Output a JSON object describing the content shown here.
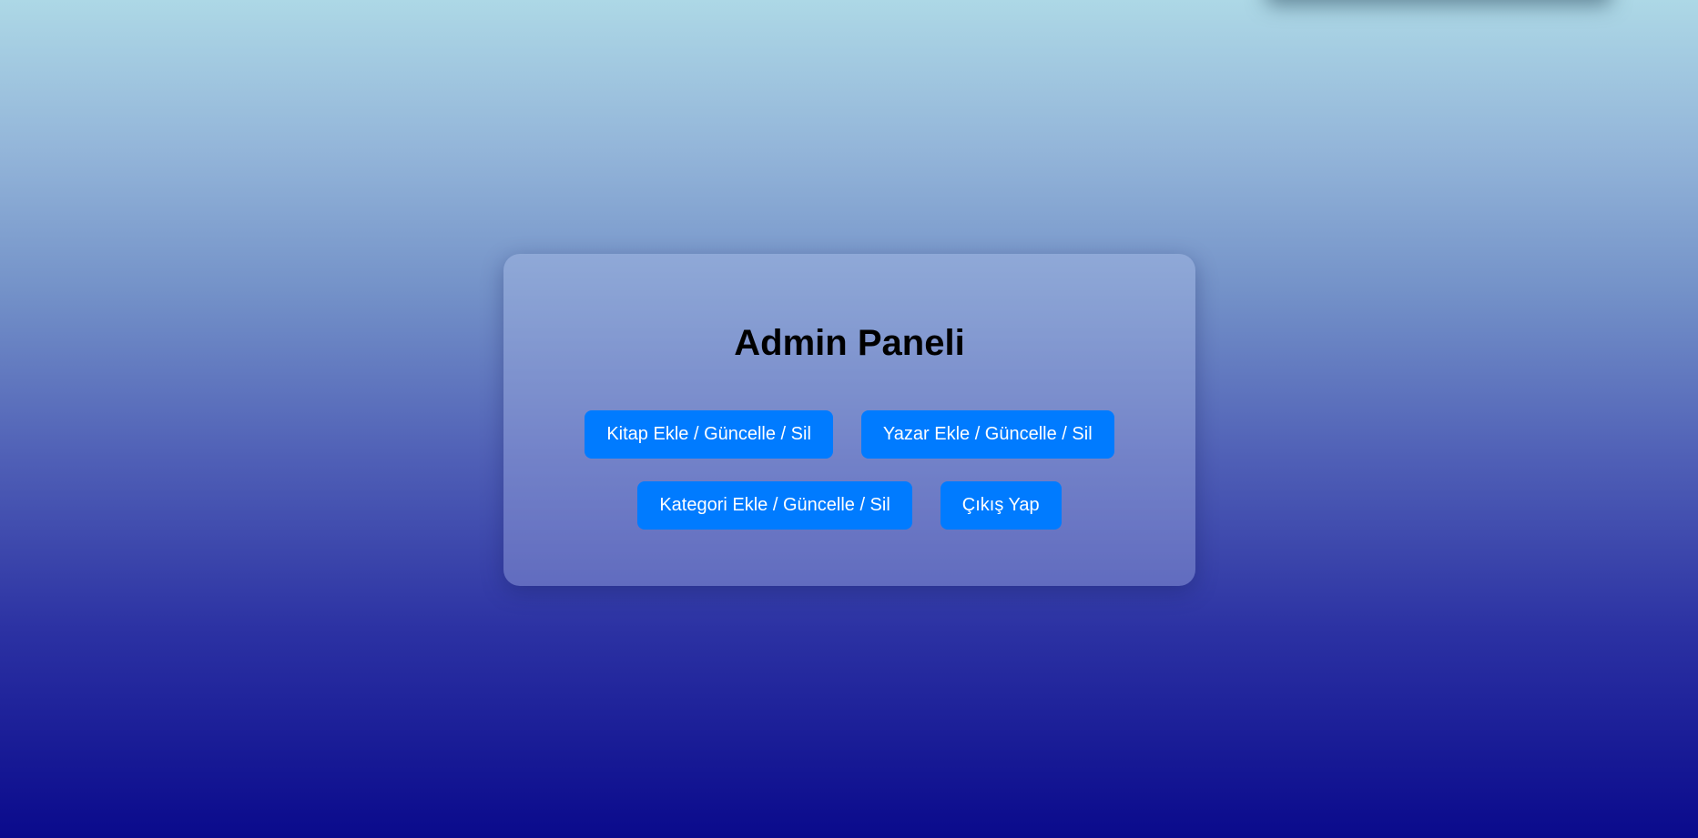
{
  "panel": {
    "title": "Admin Paneli",
    "buttons": {
      "books": "Kitap Ekle / Güncelle / Sil",
      "authors": "Yazar Ekle / Güncelle / Sil",
      "categories": "Kategori Ekle / Güncelle / Sil",
      "logout": "Çıkış Yap"
    }
  },
  "colors": {
    "button_bg": "#007bff",
    "button_text": "#ffffff",
    "gradient_top": "#add8e6",
    "gradient_bottom": "#0a0a8c"
  }
}
